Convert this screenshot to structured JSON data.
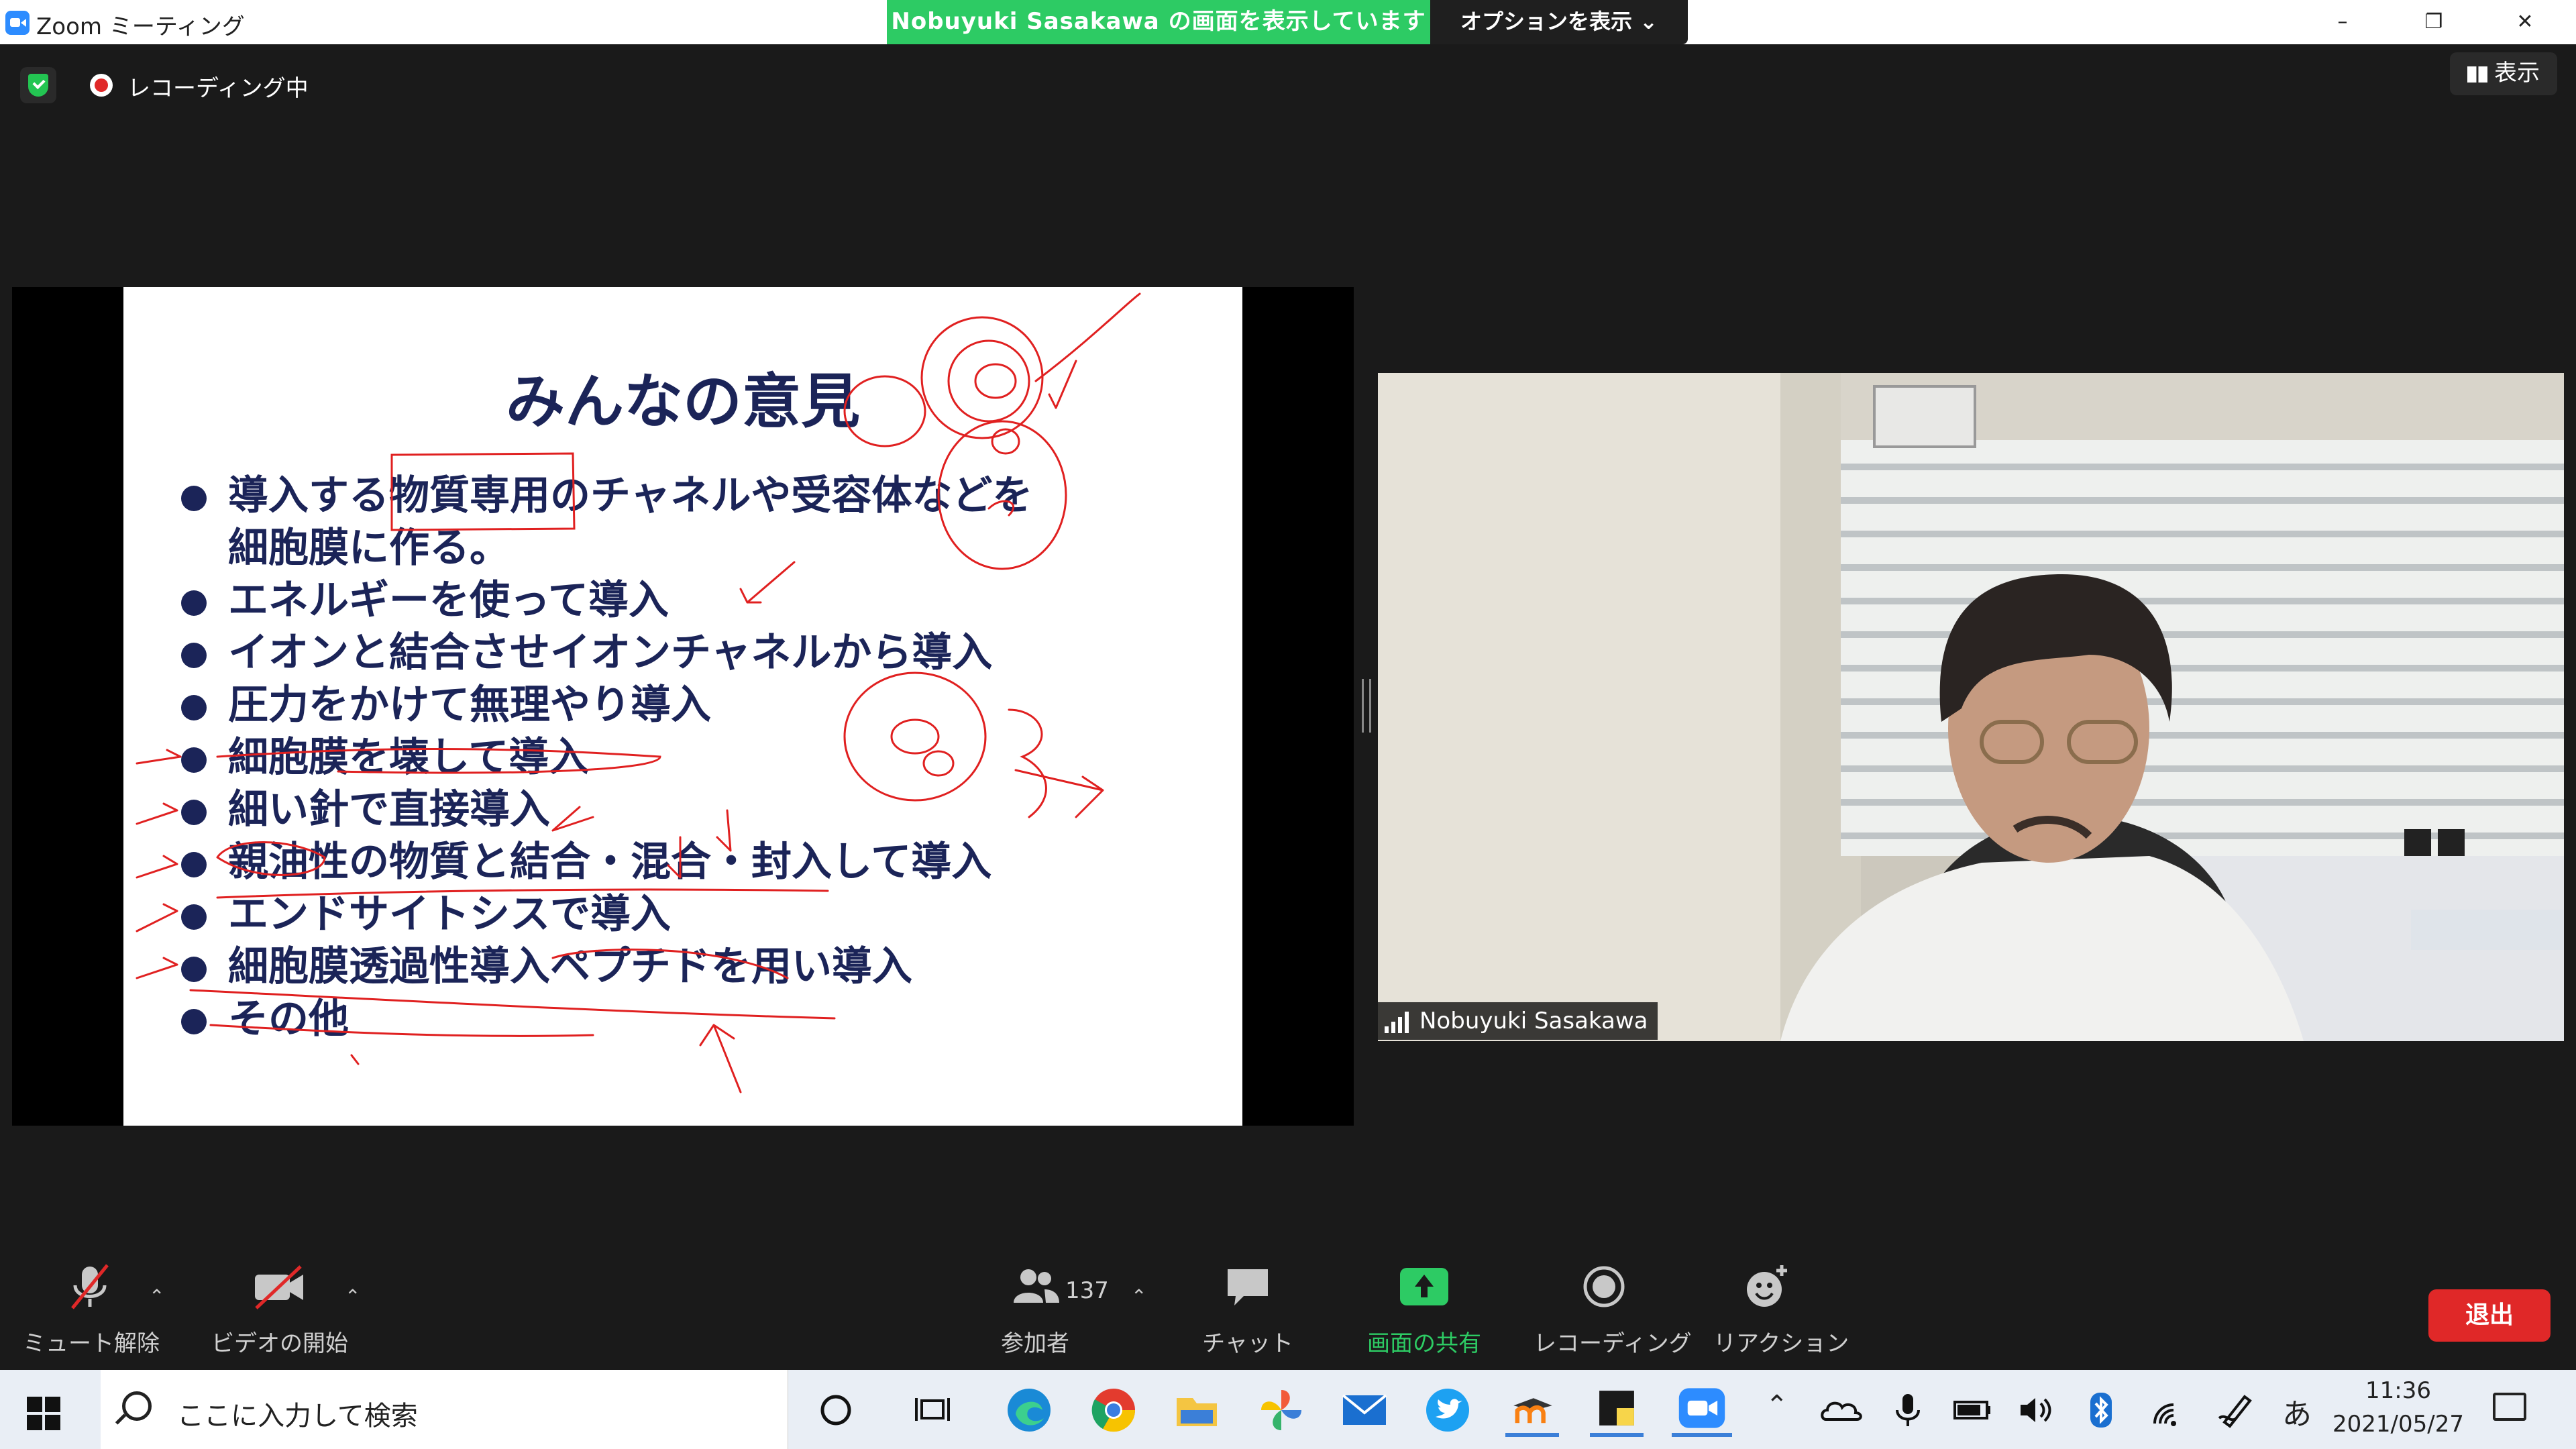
{
  "window": {
    "title": "Zoom ミーティング",
    "share_banner": "Nobuyuki  Sasakawa の画面を表示しています",
    "options_button": "オプションを表示 ⌄",
    "minimize": "–",
    "restore": "❐",
    "close": "✕"
  },
  "status": {
    "recording_label": "レコーディング中",
    "view_button": "表示"
  },
  "slide": {
    "title": "みんなの意見",
    "bullets": [
      "導入する物質専用のチャネルや受容体などを",
      "細胞膜に作る。",
      "エネルギーを使って導入",
      "イオンと結合させイオンチャネルから導入",
      "圧力をかけて無理やり導入",
      "細胞膜を壊して導入",
      "細い針で直接導入",
      "親油性の物質と結合・混合・封入して導入",
      "エンドサイトシスで導入",
      "細胞膜透過性導入ペプチドを用い導入",
      "その他"
    ]
  },
  "video": {
    "participant_name": "Nobuyuki Sasakawa"
  },
  "toolbar": {
    "unmute": "ミュート解除",
    "start_video": "ビデオの開始",
    "participants_count": "137",
    "participants": "参加者",
    "chat": "チャット",
    "share_screen": "画面の共有",
    "recording": "レコーディング",
    "reactions": "リアクション",
    "leave": "退出"
  },
  "taskbar": {
    "search_placeholder": "ここに入力して検索",
    "time": "11:36",
    "date": "2021/05/27",
    "ime": "あ"
  },
  "colors": {
    "zoom_green": "#2dcb64",
    "zoom_blue": "#2d8cff",
    "leave_red": "#e02828",
    "slide_text": "#1b2458",
    "ink_red": "#e02020"
  }
}
